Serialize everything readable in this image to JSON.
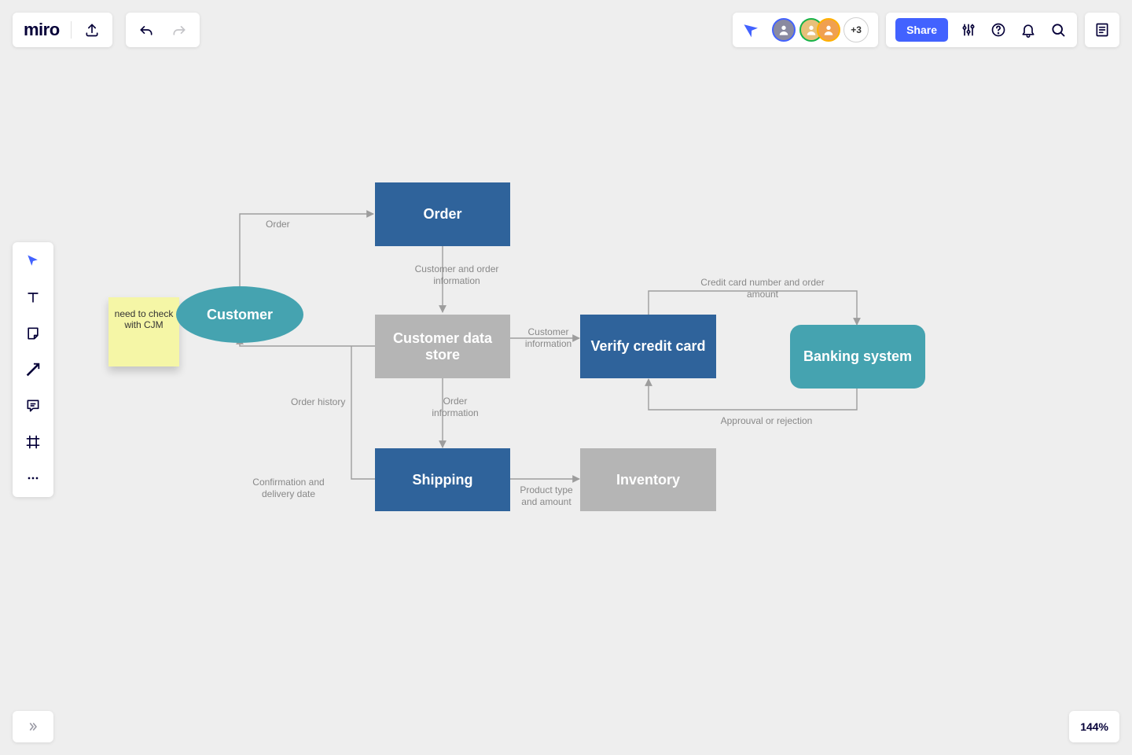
{
  "header": {
    "logo": "miro",
    "share_label": "Share",
    "more_avatars": "+3"
  },
  "footer": {
    "zoom": "144%"
  },
  "diagram": {
    "sticky_note": "need to check with CJM",
    "nodes": {
      "customer": "Customer",
      "order": "Order",
      "customer_data_store": "Customer data store",
      "verify_credit_card": "Verify credit card",
      "banking_system": "Banking system",
      "shipping": "Shipping",
      "inventory": "Inventory"
    },
    "edges": {
      "order": "Order",
      "customer_and_order_info": "Customer and order\ninformation",
      "customer_info": "Customer\ninformation",
      "credit_card_number": "Credit card number and order amount",
      "approval": "Approuval or rejection",
      "order_info": "Order\ninformation",
      "order_history": "Order history",
      "confirmation": "Confirmation and\ndelivery date",
      "product_type": "Product type\nand amount"
    }
  }
}
